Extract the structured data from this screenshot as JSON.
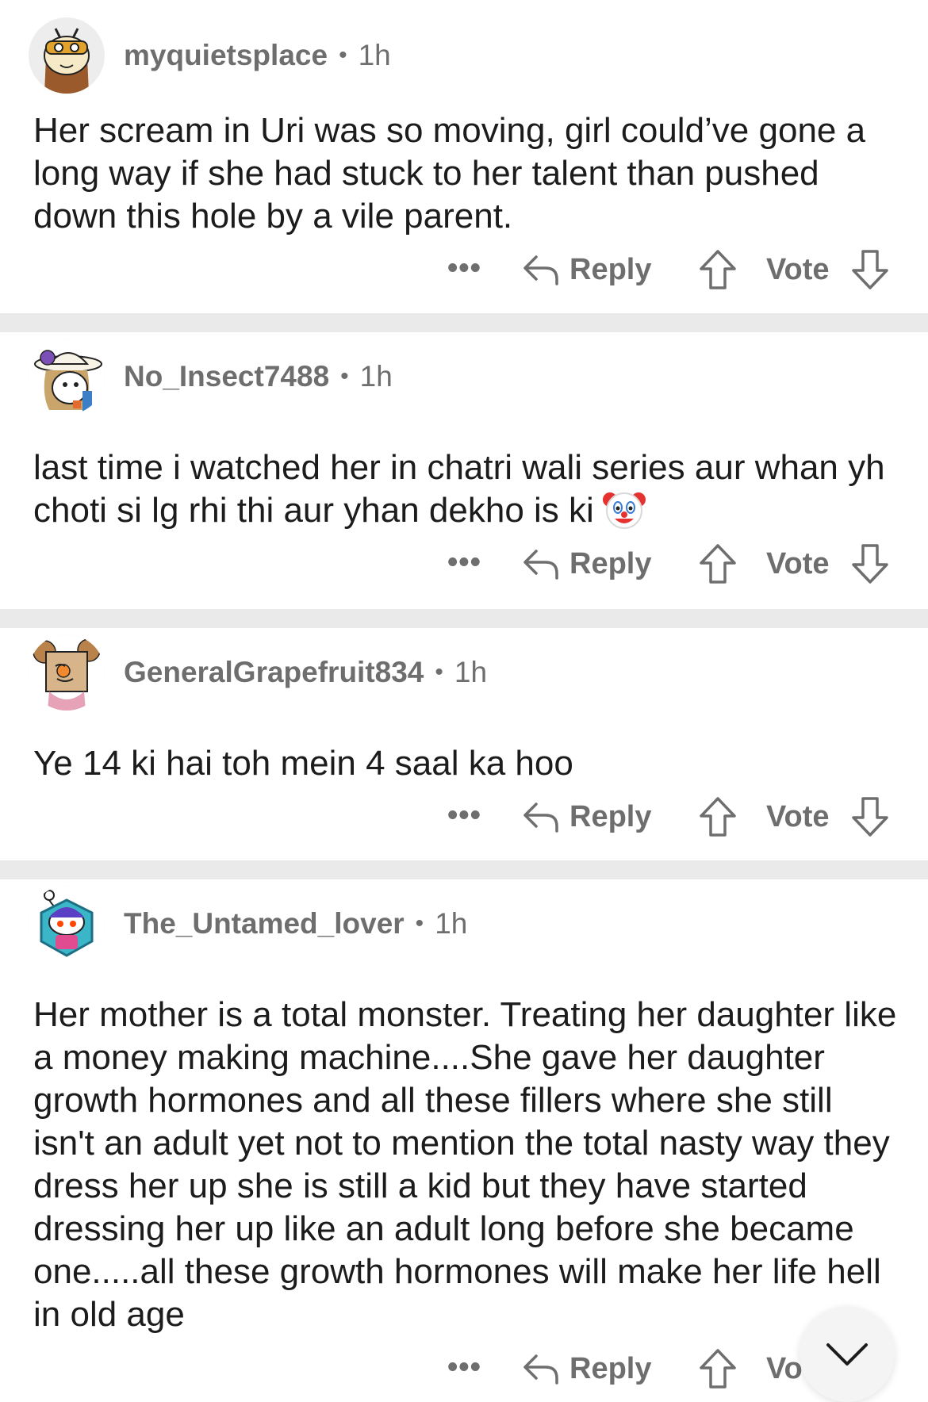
{
  "comments": [
    {
      "username": "myquietsplace",
      "separator_dot": "•",
      "time": "1h",
      "avatar_icon": "owl-avatar-icon",
      "body": "Her scream in Uri was so moving, girl could’ve gone a long way if she had stuck to her talent than pushed down this hole by a vile parent.",
      "more_label": "•••",
      "reply_label": "Reply",
      "vote_label": "Vote"
    },
    {
      "username": "No_Insect7488",
      "separator_dot": "•",
      "time": "1h",
      "avatar_icon": "sunhat-avatar-icon",
      "body": "last time i watched her in chatri wali series aur whan yh choti si lg rhi thi aur yhan dekho is ki",
      "emoji_icon": "clown-face-icon",
      "more_label": "•••",
      "reply_label": "Reply",
      "vote_label": "Vote"
    },
    {
      "username": "GeneralGrapefruit834",
      "separator_dot": "•",
      "time": "1h",
      "avatar_icon": "box-head-avatar-icon",
      "body": "Ye 14 ki hai toh mein 4 saal ka hoo",
      "more_label": "•••",
      "reply_label": "Reply",
      "vote_label": "Vote"
    },
    {
      "username": "The_Untamed_lover",
      "separator_dot": "•",
      "time": "1h",
      "avatar_icon": "hexagon-snoo-avatar-icon",
      "body": "Her mother is a total monster. Treating her daughter like a money making machine....She gave her daughter growth hormones and all these fillers where she still isn't an adult yet not to mention the total nasty way they dress her up she is still a kid but they have started dressing her up like an adult long before she became one.....all these growth hormones will make her life hell in old age",
      "more_label": "•••",
      "reply_label": "Reply",
      "vote_label": "Vo"
    }
  ],
  "scroll_button": {
    "icon": "chevron-down-icon"
  },
  "colors": {
    "text": "#1c1c1c",
    "meta": "#6e6e6e",
    "separator": "#eaeaea",
    "background": "#ffffff"
  }
}
